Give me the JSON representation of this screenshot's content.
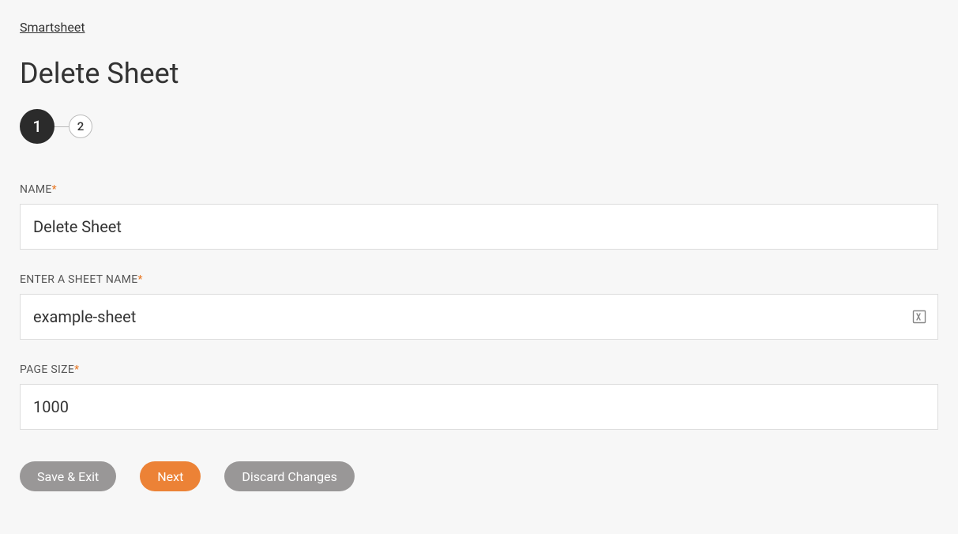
{
  "breadcrumb": {
    "label": "Smartsheet"
  },
  "page": {
    "title": "Delete Sheet"
  },
  "stepper": {
    "step1": "1",
    "step2": "2"
  },
  "form": {
    "name": {
      "label": "NAME",
      "value": "Delete Sheet"
    },
    "sheetName": {
      "label": "ENTER A SHEET NAME",
      "value": "example-sheet"
    },
    "pageSize": {
      "label": "PAGE SIZE",
      "value": "1000"
    },
    "requiredMark": "*"
  },
  "buttons": {
    "saveExit": "Save & Exit",
    "next": "Next",
    "discard": "Discard Changes"
  }
}
